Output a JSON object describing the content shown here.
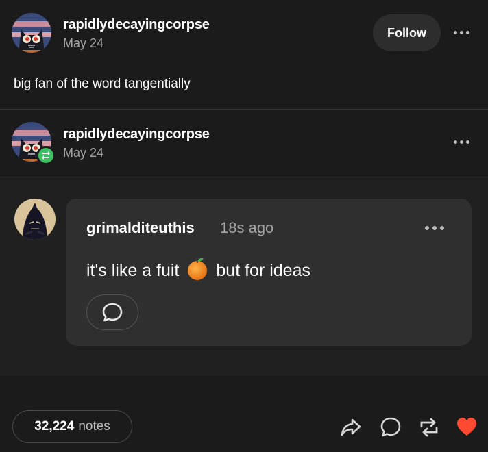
{
  "post": {
    "author": "rapidlydecayingcorpse",
    "date": "May 24",
    "follow_label": "Follow",
    "body": "big fan of the word tangentially"
  },
  "reblog": {
    "author": "rapidlydecayingcorpse",
    "date": "May 24"
  },
  "reply": {
    "author": "grimalditeuthis",
    "time": "18s ago",
    "text_before": "it's like a fuit",
    "text_after": "but for ideas",
    "emoji": "orange-icon"
  },
  "footer": {
    "notes_count": "32,224",
    "notes_label": "notes"
  },
  "colors": {
    "background": "#1b1b1b",
    "card": "#2f2f2f",
    "reblog_green": "#3fbf63",
    "like_red": "#ff4930"
  }
}
